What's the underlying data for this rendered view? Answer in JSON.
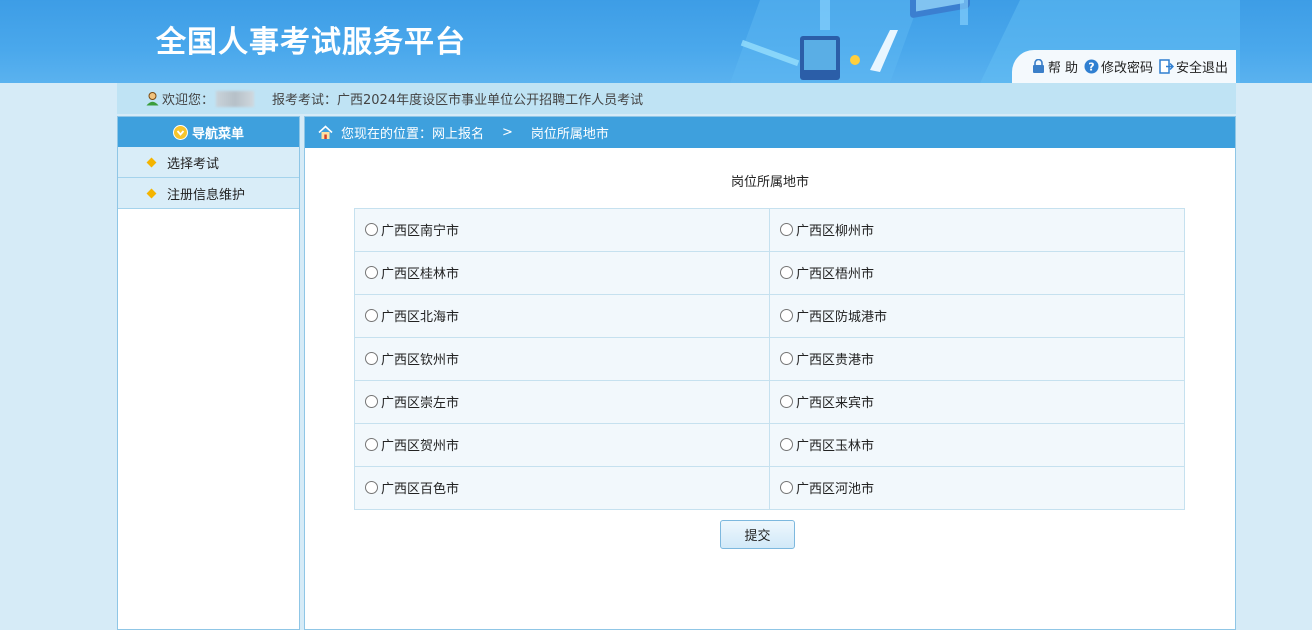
{
  "header": {
    "title": "全国人事考试服务平台",
    "links": {
      "help": "帮 助",
      "change_password": "修改密码",
      "logout": "安全退出"
    }
  },
  "userbar": {
    "welcome": "欢迎您：",
    "exam_label": "报考考试：广西2024年度设区市事业单位公开招聘工作人员考试"
  },
  "sidebar": {
    "title": "导航菜单",
    "items": [
      {
        "label": "选择考试"
      },
      {
        "label": "注册信息维护"
      }
    ]
  },
  "breadcrumb": {
    "prefix": "您现在的位置：网上报名",
    "separator": ">",
    "current": "岗位所属地市"
  },
  "form": {
    "title": "岗位所属地市",
    "options": [
      [
        "广西区南宁市",
        "广西区柳州市"
      ],
      [
        "广西区桂林市",
        "广西区梧州市"
      ],
      [
        "广西区北海市",
        "广西区防城港市"
      ],
      [
        "广西区钦州市",
        "广西区贵港市"
      ],
      [
        "广西区崇左市",
        "广西区来宾市"
      ],
      [
        "广西区贺州市",
        "广西区玉林市"
      ],
      [
        "广西区百色市",
        "广西区河池市"
      ]
    ],
    "submit_label": "提交"
  },
  "colors": {
    "banner": "#3d9de6",
    "nav_header": "#3ea0dd",
    "userbar": "#bfe3f4"
  }
}
